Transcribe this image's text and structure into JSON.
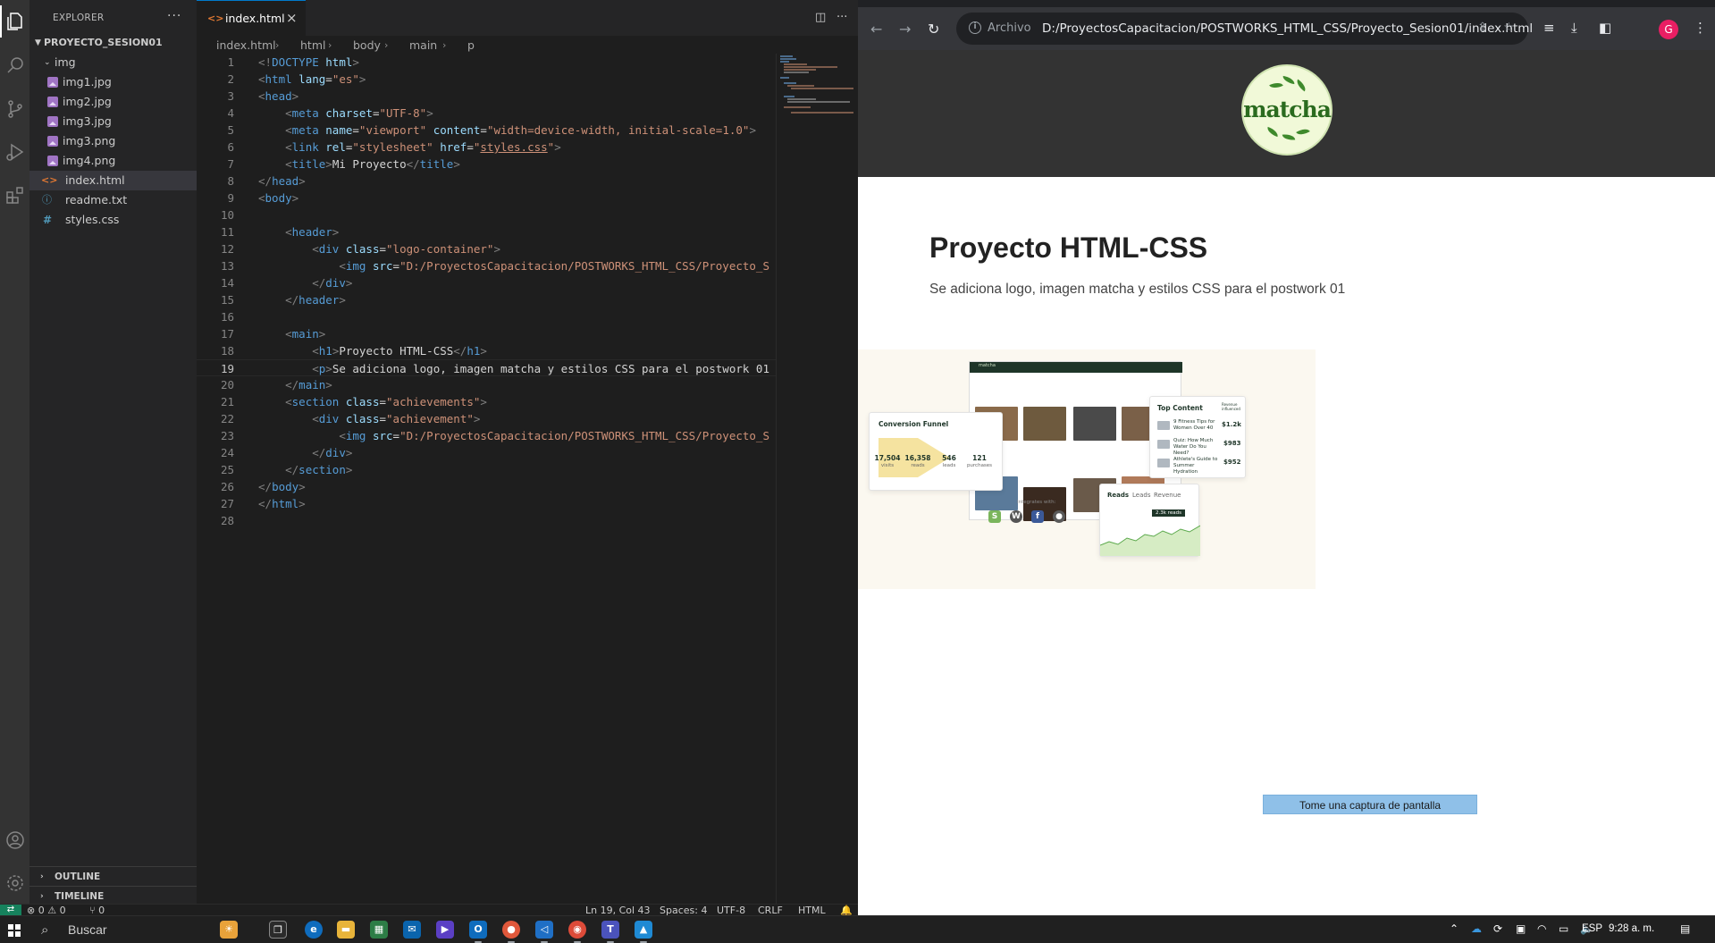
{
  "vscode": {
    "sidebar_title": "EXPLORER",
    "project_name": "PROYECTO_SESION01",
    "folder_img": "img",
    "files_img": [
      "img1.jpg",
      "img2.jpg",
      "img3.jpg",
      "img3.png",
      "img4.png"
    ],
    "files_root": [
      "index.html",
      "readme.txt",
      "styles.css"
    ],
    "outline_label": "OUTLINE",
    "timeline_label": "TIMELINE",
    "tab_label": "index.html",
    "breadcrumb": [
      "index.html",
      "html",
      "body",
      "main",
      "p"
    ],
    "current_line": 19,
    "line_count": 28,
    "status": {
      "errors": "0",
      "warnings": "0",
      "ports": "0",
      "position": "Ln 19, Col 43",
      "spaces": "Spaces: 4",
      "encoding": "UTF-8",
      "eol": "CRLF",
      "language": "HTML"
    }
  },
  "chrome": {
    "chip_label": "Archivo",
    "url": "D:/ProyectosCapacitacion/POSTWORKS_HTML_CSS/Proyecto_Sesion01/index.html",
    "avatar_letter": "G",
    "page": {
      "logo_text": "matcha",
      "title": "Proyecto HTML-CSS",
      "description": "Se adiciona logo, imagen matcha y estilos CSS para el postwork 01",
      "capture_button": "Tome una captura de pantalla",
      "mock": {
        "funnel_title": "Conversion Funnel",
        "funnel": [
          {
            "value": "17,504",
            "label": "visits"
          },
          {
            "value": "16,358",
            "label": "reads"
          },
          {
            "value": "546",
            "label": "leads"
          },
          {
            "value": "121",
            "label": "purchases"
          }
        ],
        "top_content_title": "Top Content",
        "top_content_header": "Revenue influenced",
        "top_content": [
          {
            "title": "9 Fitness Tips for Women Over 40",
            "value": "$1.2k"
          },
          {
            "title": "Quiz: How Much Water Do You Need?",
            "value": "$983"
          },
          {
            "title": "Athlete's Guide to Summer Hydration",
            "value": "$952"
          }
        ],
        "chart_tabs": [
          "Reads",
          "Leads",
          "Revenue"
        ],
        "chart_tooltip": "2.3k reads",
        "integrates_label": "Integrates with:"
      }
    }
  },
  "taskbar": {
    "search_label": "Buscar",
    "language": "ESP",
    "time": "9:28 a. m."
  },
  "colors": {
    "vscode_bg": "#1e1e1e",
    "sidebar_bg": "#252526",
    "site_header_bg": "#333333",
    "logo_green": "#2b6b1f",
    "capture_button_bg": "#8fc0e8"
  }
}
